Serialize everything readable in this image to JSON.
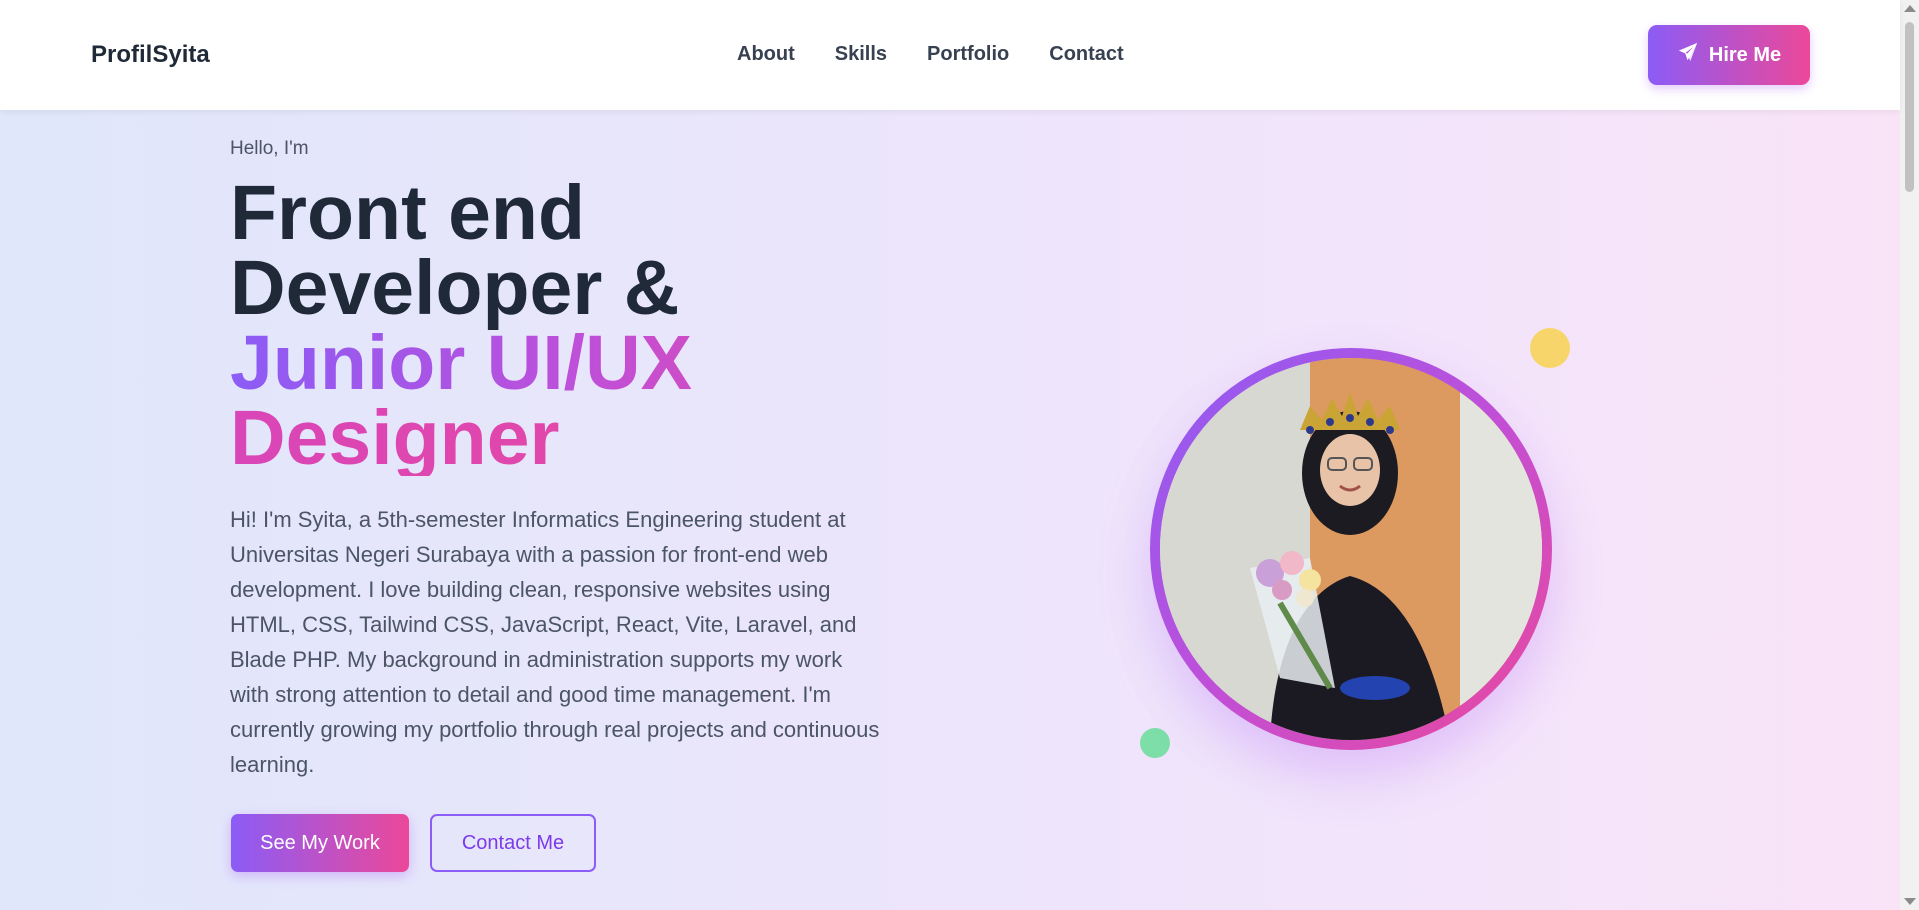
{
  "nav": {
    "brand": "ProfilSyita",
    "links": [
      "About",
      "Skills",
      "Portfolio",
      "Contact"
    ],
    "hire_label": "Hire Me",
    "hire_icon": "paper-plane-icon"
  },
  "hero": {
    "greeting": "Hello, I'm",
    "title_line1": "Front end",
    "title_line2": "Developer &",
    "title_accent_1": "Junior UI/UX",
    "title_accent_2": "Designer",
    "bio": "Hi! I'm Syita, a 5th-semester Informatics Engineering student at Universitas Negeri Surabaya with a passion for front-end web development. I love building clean, responsive websites using HTML, CSS, Tailwind CSS, JavaScript, React, Vite, Laravel, and Blade PHP. My background in administration supports my work with strong attention to detail and good time management. I'm currently growing my portfolio through real projects and continuous learning.",
    "primary_button": "See My Work",
    "secondary_button": "Contact Me"
  },
  "colors": {
    "accent_start": "#8b5cf6",
    "accent_end": "#ec4899",
    "dot_yellow": "#f8d56a",
    "dot_green": "#7ddea8"
  }
}
